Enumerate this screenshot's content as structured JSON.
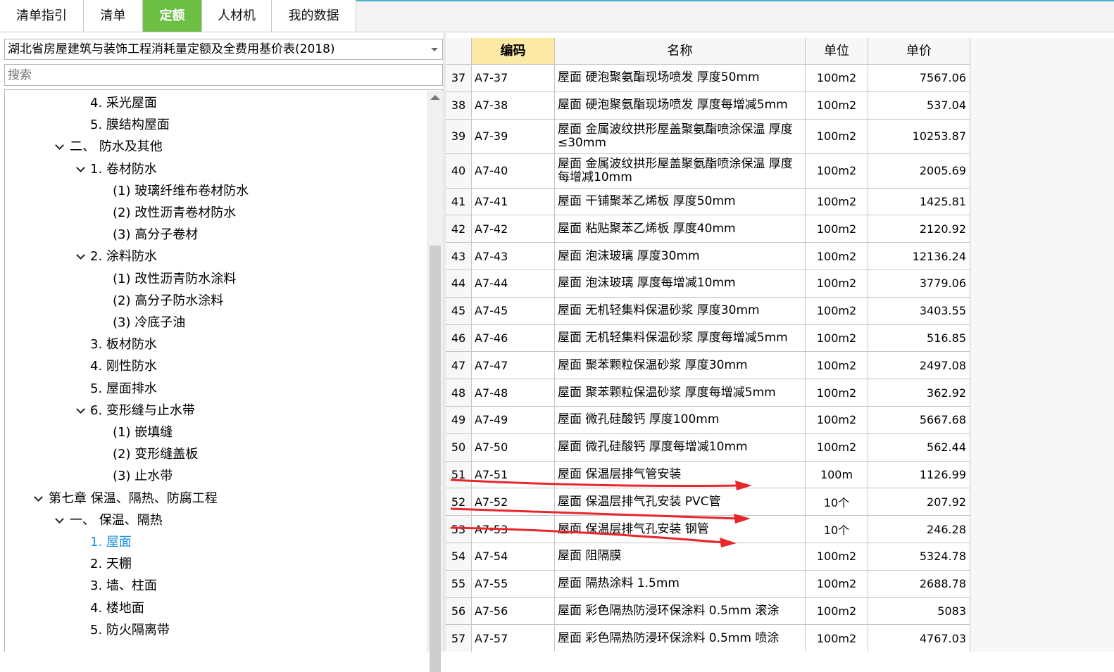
{
  "tabs": [
    {
      "label": "清单指引",
      "active": false
    },
    {
      "label": "清单",
      "active": false
    },
    {
      "label": "定额",
      "active": true
    },
    {
      "label": "人材机",
      "active": false
    },
    {
      "label": "我的数据",
      "active": false
    }
  ],
  "library": {
    "selected": "湖北省房屋建筑与装饰工程消耗量定额及全费用基价表(2018)"
  },
  "search": {
    "placeholder": "搜索"
  },
  "tree": [
    {
      "label": "4. 采光屋面",
      "expanded": null,
      "selected": false
    },
    {
      "label": "5. 膜结构屋面",
      "expanded": null,
      "selected": false
    },
    {
      "label": "二、 防水及其他",
      "expanded": true,
      "selected": false
    },
    {
      "label": "1. 卷材防水",
      "expanded": true,
      "selected": false
    },
    {
      "label": "(1) 玻璃纤维布卷材防水",
      "expanded": null,
      "selected": false
    },
    {
      "label": "(2) 改性沥青卷材防水",
      "expanded": null,
      "selected": false
    },
    {
      "label": "(3) 高分子卷材",
      "expanded": null,
      "selected": false
    },
    {
      "label": "2. 涂料防水",
      "expanded": true,
      "selected": false
    },
    {
      "label": "(1) 改性沥青防水涂料",
      "expanded": null,
      "selected": false
    },
    {
      "label": "(2) 高分子防水涂料",
      "expanded": null,
      "selected": false
    },
    {
      "label": "(3) 冷底子油",
      "expanded": null,
      "selected": false
    },
    {
      "label": "3. 板材防水",
      "expanded": null,
      "selected": false
    },
    {
      "label": "4. 刚性防水",
      "expanded": null,
      "selected": false
    },
    {
      "label": "5. 屋面排水",
      "expanded": null,
      "selected": false
    },
    {
      "label": "6. 变形缝与止水带",
      "expanded": true,
      "selected": false
    },
    {
      "label": "(1) 嵌填缝",
      "expanded": null,
      "selected": false
    },
    {
      "label": "(2) 变形缝盖板",
      "expanded": null,
      "selected": false
    },
    {
      "label": "(3) 止水带",
      "expanded": null,
      "selected": false
    },
    {
      "label": "第七章 保温、隔热、防腐工程",
      "expanded": true,
      "selected": false
    },
    {
      "label": "一、 保温、隔热",
      "expanded": true,
      "selected": false
    },
    {
      "label": "1. 屋面",
      "expanded": null,
      "selected": true
    },
    {
      "label": "2. 天棚",
      "expanded": null,
      "selected": false
    },
    {
      "label": "3. 墙、柱面",
      "expanded": null,
      "selected": false
    },
    {
      "label": "4. 楼地面",
      "expanded": null,
      "selected": false
    },
    {
      "label": "5. 防火隔离带",
      "expanded": null,
      "selected": false
    }
  ],
  "grid": {
    "headers": {
      "code": "编码",
      "name": "名称",
      "unit": "单位",
      "price": "单价"
    },
    "sorted_column": "code",
    "rows": [
      {
        "idx": "37",
        "code": "A7-37",
        "name": "屋面 硬泡聚氨酯现场喷发 厚度50mm",
        "unit": "100m2",
        "price": "7567.06"
      },
      {
        "idx": "38",
        "code": "A7-38",
        "name": "屋面 硬泡聚氨酯现场喷发 厚度每增减5mm",
        "unit": "100m2",
        "price": "537.04"
      },
      {
        "idx": "39",
        "code": "A7-39",
        "name": "屋面 金属波纹拱形屋盖聚氨酯喷涂保温 厚度≤30mm",
        "unit": "100m2",
        "price": "10253.87"
      },
      {
        "idx": "40",
        "code": "A7-40",
        "name": "屋面 金属波纹拱形屋盖聚氨酯喷涂保温 厚度每增减10mm",
        "unit": "100m2",
        "price": "2005.69"
      },
      {
        "idx": "41",
        "code": "A7-41",
        "name": "屋面 干铺聚苯乙烯板 厚度50mm",
        "unit": "100m2",
        "price": "1425.81"
      },
      {
        "idx": "42",
        "code": "A7-42",
        "name": "屋面 粘贴聚苯乙烯板 厚度40mm",
        "unit": "100m2",
        "price": "2120.92"
      },
      {
        "idx": "43",
        "code": "A7-43",
        "name": "屋面 泡沫玻璃 厚度30mm",
        "unit": "100m2",
        "price": "12136.24"
      },
      {
        "idx": "44",
        "code": "A7-44",
        "name": "屋面 泡沫玻璃 厚度每增减10mm",
        "unit": "100m2",
        "price": "3779.06"
      },
      {
        "idx": "45",
        "code": "A7-45",
        "name": "屋面 无机轻集料保温砂浆 厚度30mm",
        "unit": "100m2",
        "price": "3403.55"
      },
      {
        "idx": "46",
        "code": "A7-46",
        "name": "屋面 无机轻集料保温砂浆 厚度每增减5mm",
        "unit": "100m2",
        "price": "516.85"
      },
      {
        "idx": "47",
        "code": "A7-47",
        "name": "屋面 聚苯颗粒保温砂浆 厚度30mm",
        "unit": "100m2",
        "price": "2497.08"
      },
      {
        "idx": "48",
        "code": "A7-48",
        "name": "屋面 聚苯颗粒保温砂浆 厚度每增减5mm",
        "unit": "100m2",
        "price": "362.92"
      },
      {
        "idx": "49",
        "code": "A7-49",
        "name": "屋面 微孔硅酸钙 厚度100mm",
        "unit": "100m2",
        "price": "5667.68"
      },
      {
        "idx": "50",
        "code": "A7-50",
        "name": "屋面 微孔硅酸钙 厚度每增减10mm",
        "unit": "100m2",
        "price": "562.44"
      },
      {
        "idx": "51",
        "code": "A7-51",
        "name": "屋面 保温层排气管安装",
        "unit": "100m",
        "price": "1126.99"
      },
      {
        "idx": "52",
        "code": "A7-52",
        "name": "屋面 保温层排气孔安装 PVC管",
        "unit": "10个",
        "price": "207.92"
      },
      {
        "idx": "53",
        "code": "A7-53",
        "name": "屋面 保温层排气孔安装 钢管",
        "unit": "10个",
        "price": "246.28"
      },
      {
        "idx": "54",
        "code": "A7-54",
        "name": "屋面 阻隔膜",
        "unit": "100m2",
        "price": "5324.78"
      },
      {
        "idx": "55",
        "code": "A7-55",
        "name": "屋面 隔热涂料 1.5mm",
        "unit": "100m2",
        "price": "2688.78"
      },
      {
        "idx": "56",
        "code": "A7-56",
        "name": "屋面 彩色隔热防浸环保涂料 0.5mm 滚涂",
        "unit": "100m2",
        "price": "5083"
      },
      {
        "idx": "57",
        "code": "A7-57",
        "name": "屋面 彩色隔热防浸环保涂料 0.5mm 喷涂",
        "unit": "100m2",
        "price": "4767.03"
      }
    ]
  },
  "colors": {
    "active_tab": "#6cbf43",
    "sorted_header": "#fde9a6",
    "selected_tree_item": "#1a8fe0",
    "annotation": "#e8262b"
  }
}
